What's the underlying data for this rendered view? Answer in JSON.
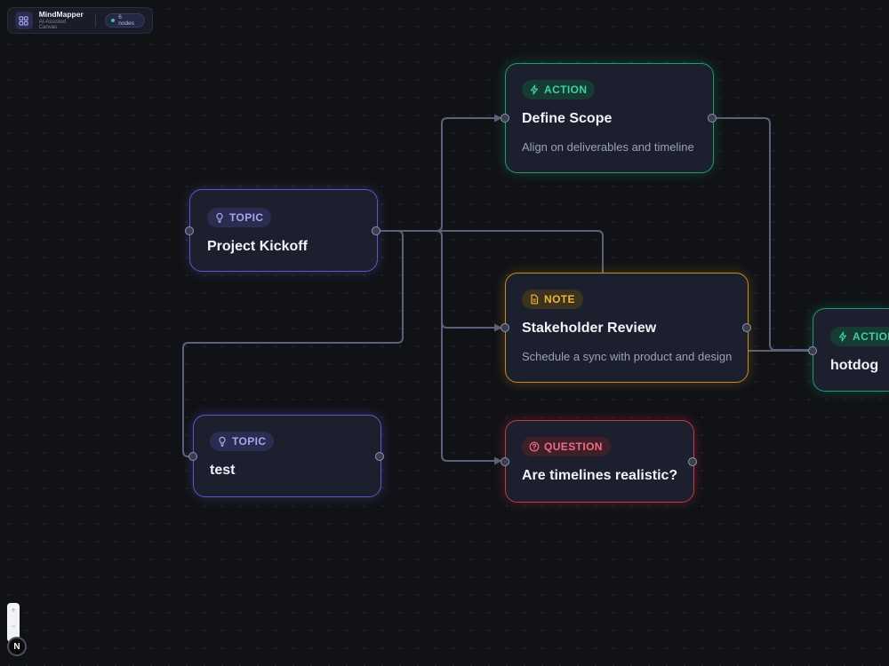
{
  "app": {
    "name": "MindMapper",
    "subtitle": "AI-Assisted Canvas",
    "node_count": "6 nodes"
  },
  "nodes": {
    "kickoff": {
      "type_label": "TOPIC",
      "title": "Project Kickoff"
    },
    "test": {
      "type_label": "TOPIC",
      "title": "test"
    },
    "scope": {
      "type_label": "ACTION",
      "title": "Define Scope",
      "description": "Align on deliverables and timeline"
    },
    "review": {
      "type_label": "NOTE",
      "title": "Stakeholder Review",
      "description": "Schedule a sync with product and design"
    },
    "question": {
      "type_label": "QUESTION",
      "title": "Are timelines realistic?"
    },
    "hotdog": {
      "type_label": "ACTION",
      "title": "hotdog"
    }
  },
  "icons": {
    "topic": "lightbulb-icon",
    "action": "bolt-icon",
    "note": "document-icon",
    "question": "question-circle-icon",
    "logo": "grid-icon"
  },
  "colors": {
    "topic": "#5c58c4",
    "action": "#1f9a74",
    "note": "#c58a22",
    "question": "#c2384e",
    "edge": "#5a6178"
  },
  "controls": {
    "zoom_in": "+",
    "zoom_out": "−",
    "avatar_initial": "N"
  }
}
